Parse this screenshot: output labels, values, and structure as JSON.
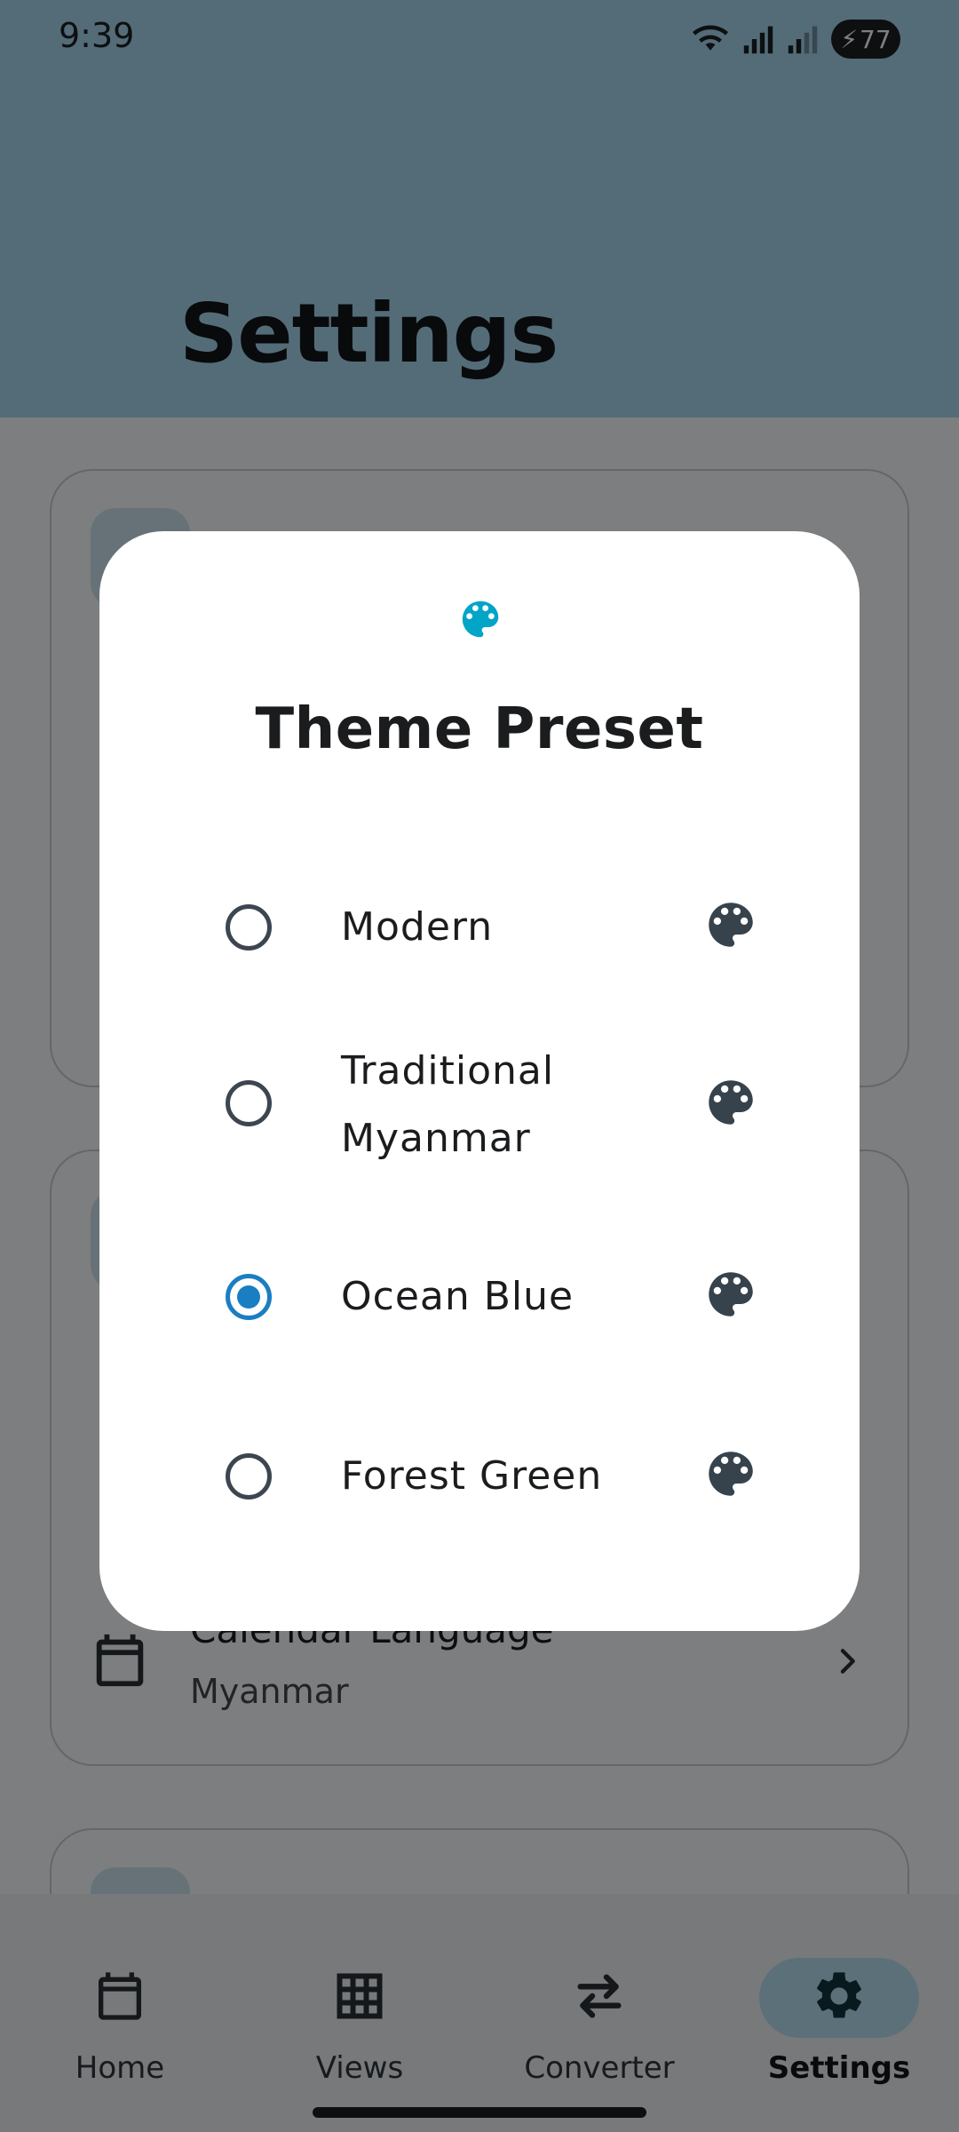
{
  "status_bar": {
    "time": "9:39",
    "battery": "77"
  },
  "app_bar": {
    "title": "Settings"
  },
  "settings": {
    "calendar_language": {
      "title": "Calendar Language",
      "value": "Myanmar"
    }
  },
  "dialog": {
    "title": "Theme Preset",
    "icon": "palette-icon",
    "accent_color": "#00a5c8",
    "options": [
      {
        "label": "Modern",
        "selected": false
      },
      {
        "label": "Traditional\nMyanmar",
        "selected": false
      },
      {
        "label": "Ocean Blue",
        "selected": true
      },
      {
        "label": "Forest Green",
        "selected": false
      }
    ]
  },
  "bottom_nav": {
    "items": [
      {
        "label": "Home",
        "icon": "calendar-icon",
        "active": false
      },
      {
        "label": "Views",
        "icon": "grid-icon",
        "active": false
      },
      {
        "label": "Converter",
        "icon": "swap-arrows-icon",
        "active": false
      },
      {
        "label": "Settings",
        "icon": "gear-icon",
        "active": true
      }
    ]
  }
}
